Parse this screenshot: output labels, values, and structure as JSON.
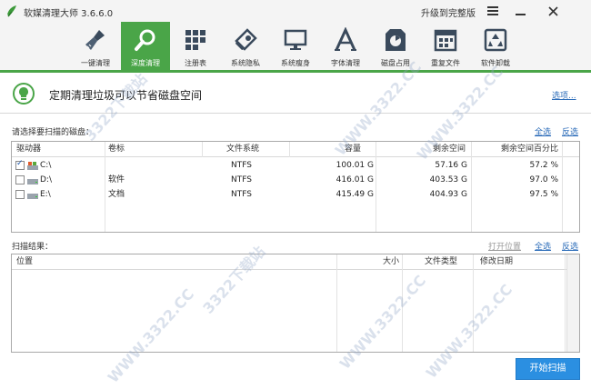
{
  "window": {
    "title": "软媒清理大师 3.6.6.0",
    "upgrade_label": "升级到完整版"
  },
  "toolbar": {
    "items": [
      {
        "label": "一键清理",
        "icon": "broom-icon",
        "active": false
      },
      {
        "label": "深度清理",
        "icon": "magnifier-icon",
        "active": true
      },
      {
        "label": "注册表",
        "icon": "registry-blocks-icon",
        "active": false
      },
      {
        "label": "系统隐私",
        "icon": "privacy-eraser-icon",
        "active": false
      },
      {
        "label": "系统瘦身",
        "icon": "monitor-icon",
        "active": false
      },
      {
        "label": "字体清理",
        "icon": "font-a-icon",
        "active": false
      },
      {
        "label": "磁盘占用",
        "icon": "disk-usage-icon",
        "active": false
      },
      {
        "label": "重复文件",
        "icon": "duplicate-files-icon",
        "active": false
      },
      {
        "label": "软件卸载",
        "icon": "recycle-icon",
        "active": false
      }
    ]
  },
  "banner": {
    "text": "定期清理垃圾可以节省磁盘空间",
    "options_link": "选项..."
  },
  "drives": {
    "section_label": "请选择要扫描的磁盘：",
    "select_all": "全选",
    "invert": "反选",
    "columns": [
      "驱动器",
      "卷标",
      "文件系统",
      "容量",
      "剩余空间",
      "剩余空间百分比"
    ],
    "rows": [
      {
        "drive": "C:\\",
        "label": "",
        "fs": "NTFS",
        "capacity": "100.01 G",
        "free": "57.16 G",
        "percent": "57.2 %",
        "checked": true
      },
      {
        "drive": "D:\\",
        "label": "软件",
        "fs": "NTFS",
        "capacity": "416.01 G",
        "free": "403.53 G",
        "percent": "97.0 %",
        "checked": false
      },
      {
        "drive": "E:\\",
        "label": "文档",
        "fs": "NTFS",
        "capacity": "415.49 G",
        "free": "404.93 G",
        "percent": "97.5 %",
        "checked": false
      }
    ]
  },
  "results": {
    "section_label": "扫描结果：",
    "open_location": "打开位置",
    "select_all": "全选",
    "invert": "反选",
    "columns": [
      "位置",
      "大小",
      "文件类型",
      "修改日期"
    ]
  },
  "actions": {
    "scan_label": "开始扫描"
  },
  "watermark": "WWW.3322.CC",
  "watermark_cn": "3322下载站",
  "colors": {
    "accent_green": "#4aa548",
    "link_blue": "#2a6bb8",
    "button_blue": "#2b8fe1"
  }
}
